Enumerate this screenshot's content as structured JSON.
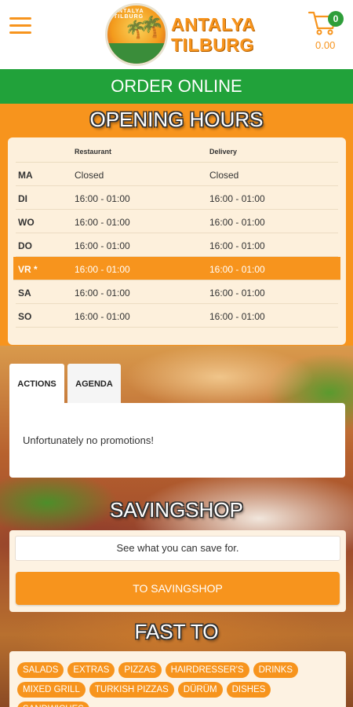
{
  "header": {
    "menu_icon": "hamburger-icon",
    "logo_line1": "ANTALYA",
    "logo_line2": "TILBURG",
    "logo_badge_text": "ANTALYA TILBURG",
    "cart_icon": "shopping-cart-icon",
    "cart_count": "0",
    "cart_total": "0.00"
  },
  "order_online": "ORDER ONLINE",
  "opening_hours": {
    "title": "OPENING HOURS",
    "columns": [
      "Restaurant",
      "Delivery"
    ],
    "rows": [
      {
        "day": "MA",
        "restaurant": "Closed",
        "delivery": "Closed"
      },
      {
        "day": "DI",
        "restaurant": "16:00 - 01:00",
        "delivery": "16:00 - 01:00"
      },
      {
        "day": "WO",
        "restaurant": "16:00 - 01:00",
        "delivery": "16:00 - 01:00"
      },
      {
        "day": "DO",
        "restaurant": "16:00 - 01:00",
        "delivery": "16:00 - 01:00"
      },
      {
        "day": "VR *",
        "restaurant": "16:00 - 01:00",
        "delivery": "16:00 - 01:00",
        "today": true
      },
      {
        "day": "SA",
        "restaurant": "16:00 - 01:00",
        "delivery": "16:00 - 01:00"
      },
      {
        "day": "SO",
        "restaurant": "16:00 - 01:00",
        "delivery": "16:00 - 01:00"
      }
    ]
  },
  "tabs": [
    "ACTIONS",
    "AGENDA"
  ],
  "promotions_text": "Unfortunately no promotions!",
  "savingshop": {
    "title": "SAVINGSHOP",
    "subtitle": "See what you can save for.",
    "button": "TO SAVINGSHOP"
  },
  "fast_to": {
    "title": "FAST TO",
    "items": [
      "SALADS",
      "EXTRAS",
      "PIZZAS",
      "HAIRDRESSER'S",
      "DRINKS",
      "MIXED GRILL",
      "TURKISH PIZZAS",
      "DÜRÜM",
      "DISHES",
      "SANDWICHES"
    ]
  },
  "colors": {
    "accent": "#f7941d",
    "order_bar": "#21a23a",
    "badge": "#2e9e3a"
  }
}
